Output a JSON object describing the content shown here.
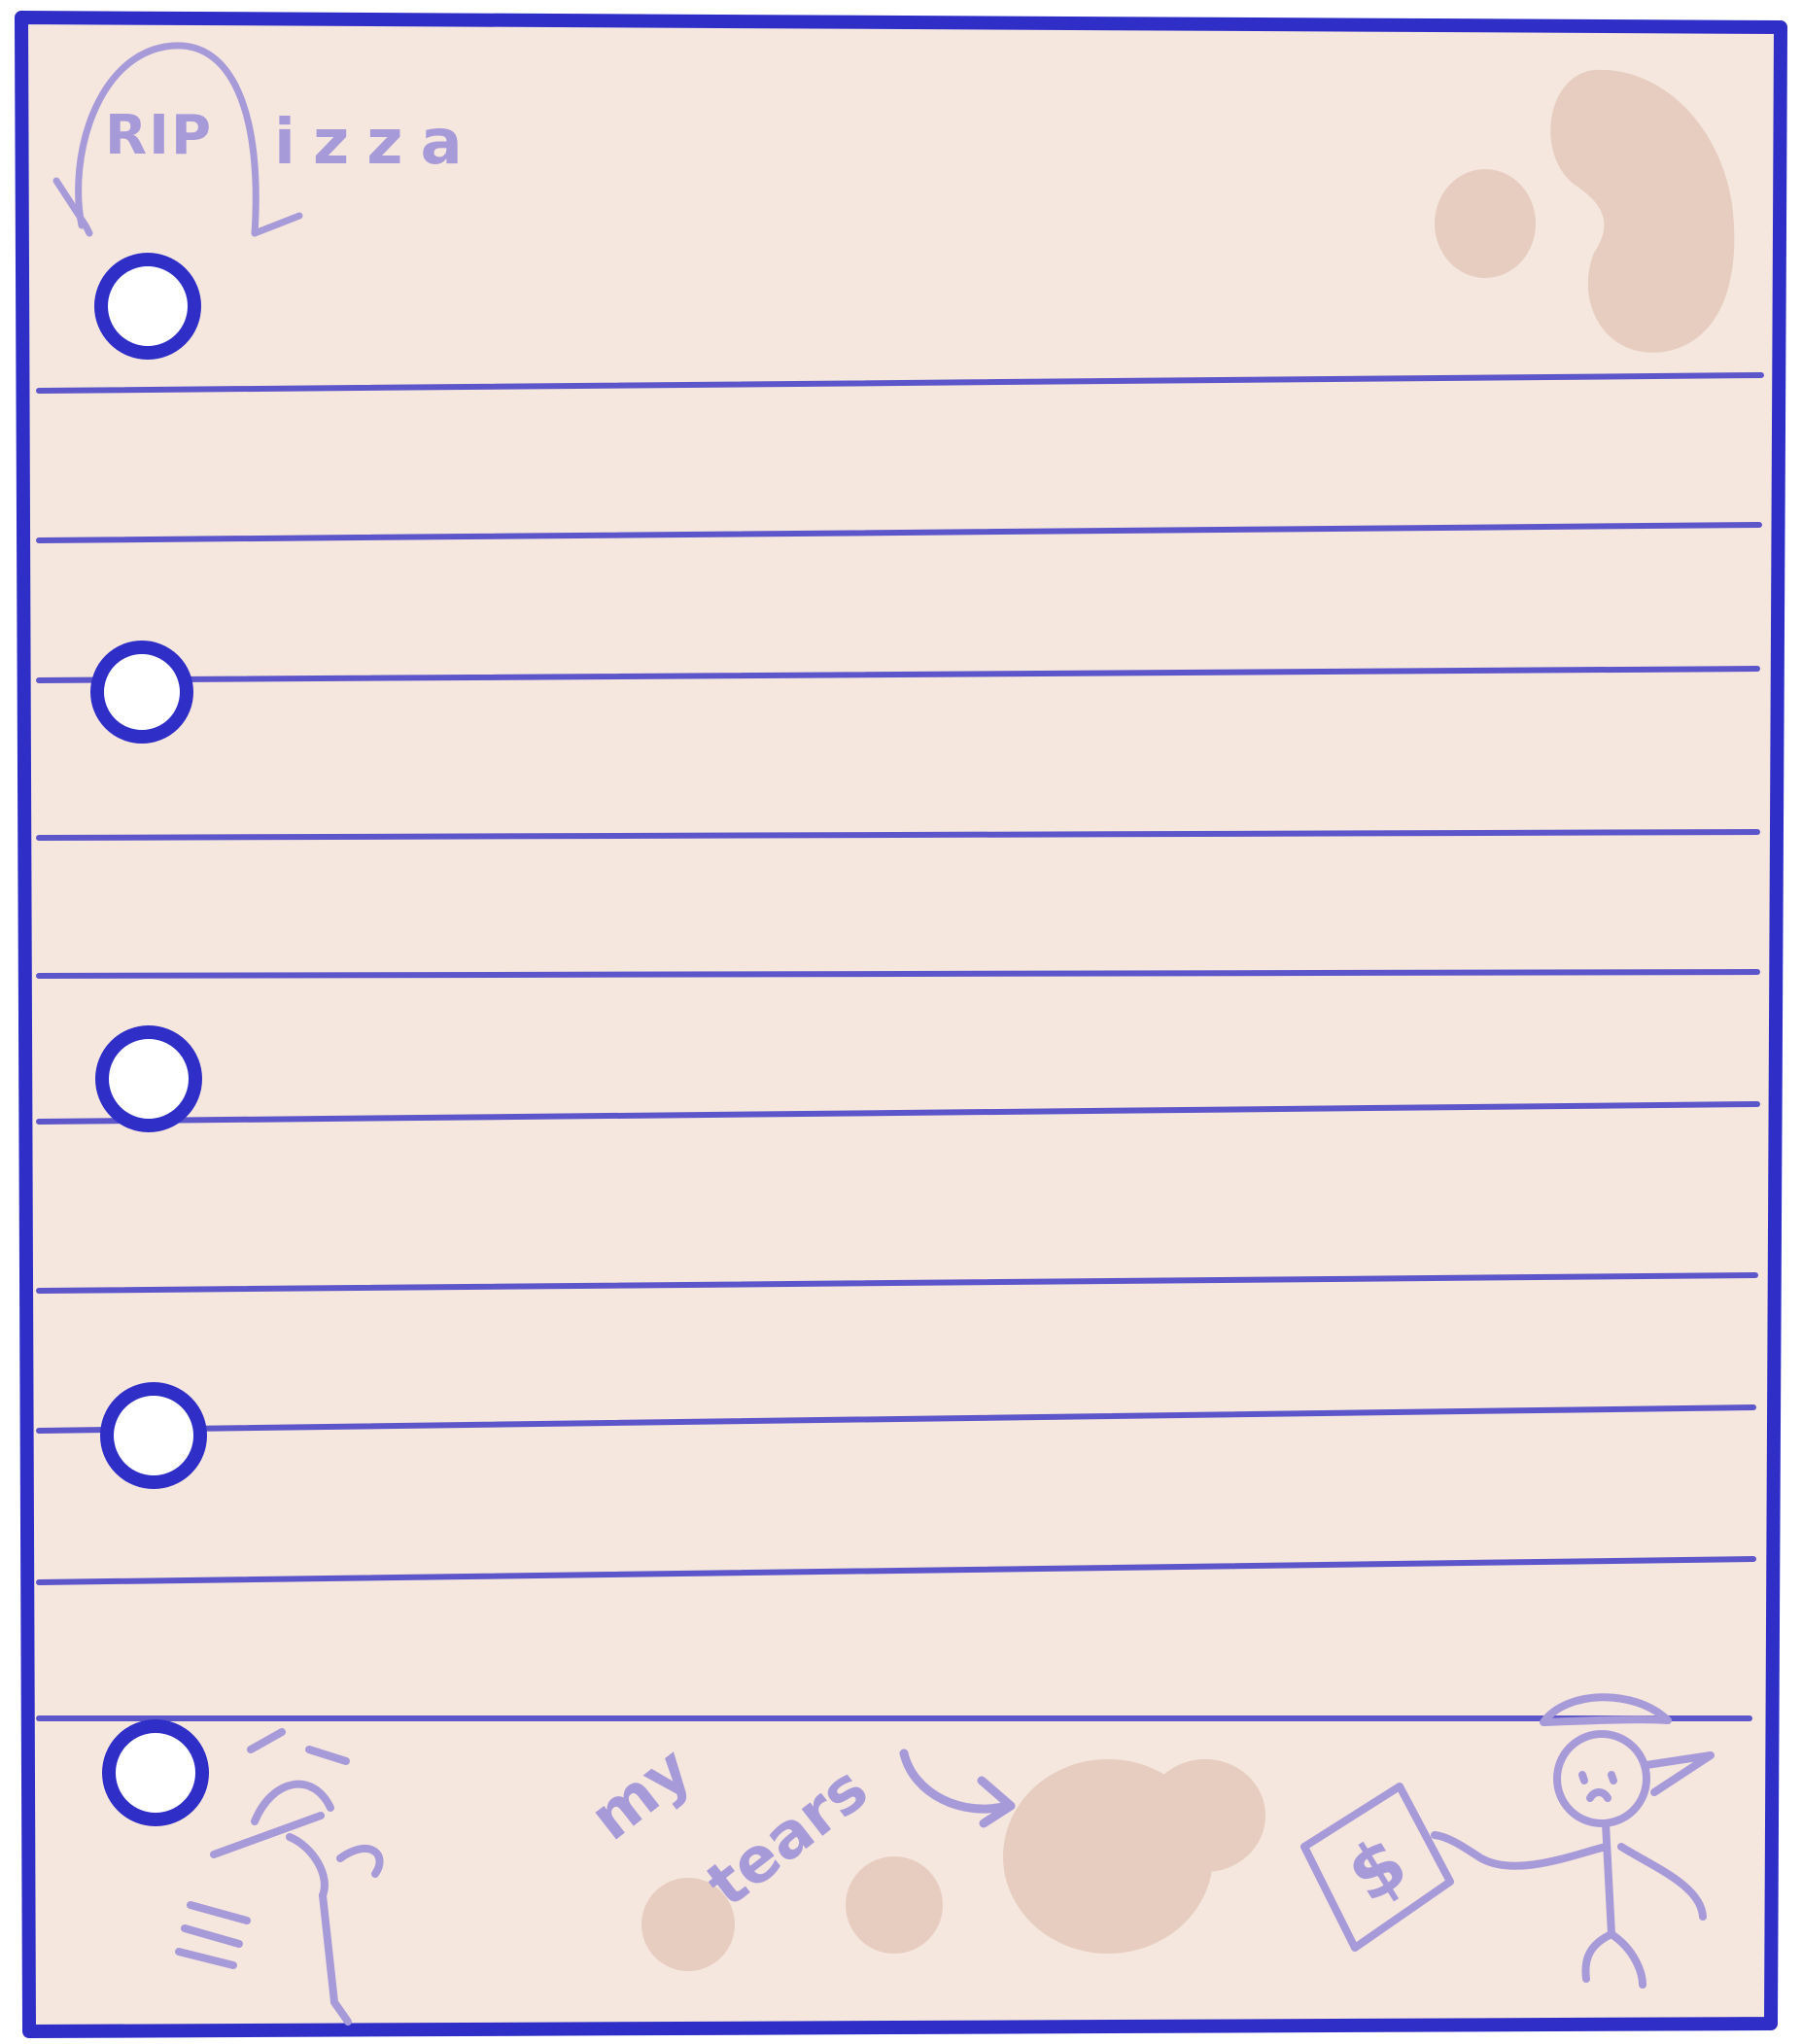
{
  "drawing": {
    "paper_color": "#f5e6de",
    "ink_color": "#2f2fc8",
    "line_color": "#4d45c8",
    "doodle_color": "#a79ad8",
    "stain_color": "#e6cdbf",
    "hole_fill": "#ffffff",
    "doodles": {
      "tombstone_text": "RIP",
      "pizza_text": "izza",
      "tears_word_1": "my",
      "tears_word_2": "tears",
      "money_symbol": "$"
    },
    "icons": [
      "tombstone-icon",
      "running-figure-icon",
      "coffee-stain-icon",
      "money-bill-icon",
      "stick-figure-icon"
    ]
  }
}
